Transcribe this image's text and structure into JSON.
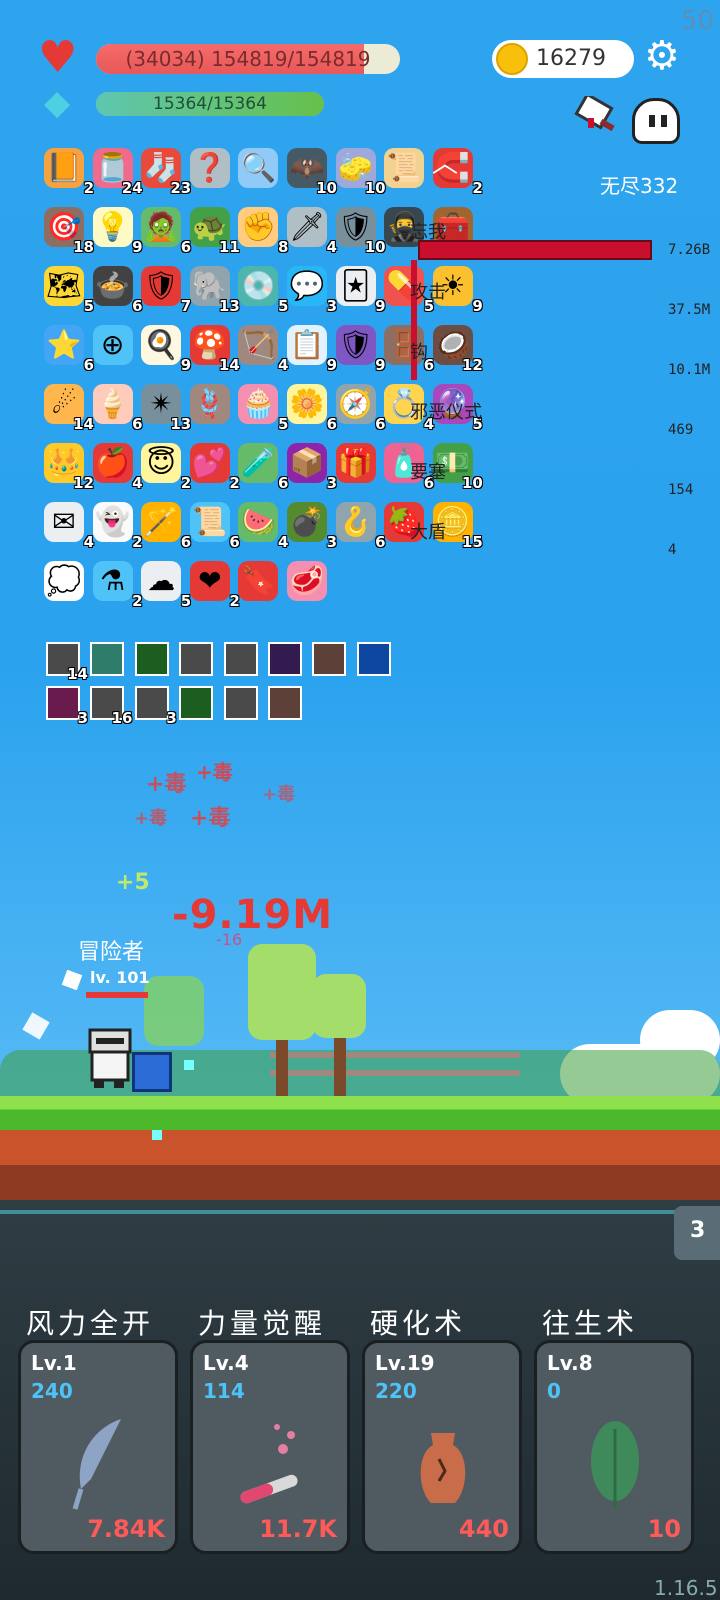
{
  "fps": "50",
  "player": {
    "hp_text": "(34034) 154819/154819",
    "hp_fraction": 0.88,
    "mp_text": "15364/15364",
    "mp_fraction": 1.0,
    "name": "冒险者",
    "level": "lv. 101"
  },
  "coins": "16279",
  "stage": "无尽332",
  "items": [
    {
      "icon": "book-icon",
      "glyph": "📙",
      "count": "2",
      "bg": "#f4a340"
    },
    {
      "icon": "jam-jar-icon",
      "glyph": "🫙",
      "count": "24",
      "bg": "#ef6a8c"
    },
    {
      "icon": "sock-icon",
      "glyph": "🧦",
      "count": "23",
      "bg": "#e84a3c"
    },
    {
      "icon": "hook-icon",
      "glyph": "❓",
      "count": "",
      "bg": "#b0bec5"
    },
    {
      "icon": "magnifier-icon",
      "glyph": "🔍",
      "count": "",
      "bg": "#90caf9"
    },
    {
      "icon": "bat-icon",
      "glyph": "🦇",
      "count": "10",
      "bg": "#455a64"
    },
    {
      "icon": "eraser-icon",
      "glyph": "🧽",
      "count": "10",
      "bg": "#9fa8da"
    },
    {
      "icon": "scroll-icon",
      "glyph": "📜",
      "count": "",
      "bg": "#f2d290"
    },
    {
      "icon": "magnet-icon",
      "glyph": "🧲",
      "count": "2",
      "bg": "#e53935"
    },
    {
      "icon": "target-disk-icon",
      "glyph": "🎯",
      "count": "18",
      "bg": "#8d6e63"
    },
    {
      "icon": "lightbulb-icon",
      "glyph": "💡",
      "count": "9",
      "bg": "#fff9c4"
    },
    {
      "icon": "zombie-icon",
      "glyph": "🧟",
      "count": "6",
      "bg": "#66bb6a"
    },
    {
      "icon": "turtle-shell-icon",
      "glyph": "🐢",
      "count": "11",
      "bg": "#43a047"
    },
    {
      "icon": "fist-icon",
      "glyph": "✊",
      "count": "8",
      "bg": "#ffcc80"
    },
    {
      "icon": "sword-icon",
      "glyph": "🗡",
      "count": "4",
      "bg": "#b0bec5"
    },
    {
      "icon": "shield-icon",
      "glyph": "🛡",
      "count": "10",
      "bg": "#78909c"
    },
    {
      "icon": "hood-icon",
      "glyph": "🥷",
      "count": "",
      "bg": "#37474f"
    },
    {
      "icon": "treasure-chest-icon",
      "glyph": "🧰",
      "count": "",
      "bg": "#a1662f"
    },
    {
      "icon": "map-icon",
      "glyph": "🗺",
      "count": "5",
      "bg": "#fdd835"
    },
    {
      "icon": "cauldron-icon",
      "glyph": "🍲",
      "count": "6",
      "bg": "#424242"
    },
    {
      "icon": "red-shield-icon",
      "glyph": "🛡",
      "count": "7",
      "bg": "#e53935"
    },
    {
      "icon": "elephant-icon",
      "glyph": "🐘",
      "count": "13",
      "bg": "#90a4ae"
    },
    {
      "icon": "disc-icon",
      "glyph": "💿",
      "count": "5",
      "bg": "#4db6ac"
    },
    {
      "icon": "chat-bubble-icon",
      "glyph": "💬",
      "count": "3",
      "bg": "#29b6f6"
    },
    {
      "icon": "playing-card-icon",
      "glyph": "🃏",
      "count": "9",
      "bg": "#eceff1"
    },
    {
      "icon": "pill-icon",
      "glyph": "💊",
      "count": "5",
      "bg": "#ef5350"
    },
    {
      "icon": "sun-icon",
      "glyph": "☀",
      "count": "9",
      "bg": "#fbc02d"
    },
    {
      "icon": "star-ticket-icon",
      "glyph": "⭐",
      "count": "6",
      "bg": "#42a5f5"
    },
    {
      "icon": "crosshair-icon",
      "glyph": "⊕",
      "count": "",
      "bg": "#4fc3f7"
    },
    {
      "icon": "fried-egg-icon",
      "glyph": "🍳",
      "count": "9",
      "bg": "#fff8e1"
    },
    {
      "icon": "mushroom-icon",
      "glyph": "🍄",
      "count": "14",
      "bg": "#e53935"
    },
    {
      "icon": "bow-icon",
      "glyph": "🏹",
      "count": "4",
      "bg": "#a1887f"
    },
    {
      "icon": "clipboard-icon",
      "glyph": "📋",
      "count": "9",
      "bg": "#e3f2fd"
    },
    {
      "icon": "purple-shield-icon",
      "glyph": "🛡",
      "count": "9",
      "bg": "#7e57c2"
    },
    {
      "icon": "door-icon",
      "glyph": "🚪",
      "count": "6",
      "bg": "#8d6e63"
    },
    {
      "icon": "coconut-icon",
      "glyph": "🥥",
      "count": "12",
      "bg": "#6d4c41"
    },
    {
      "icon": "meteor-icon",
      "glyph": "☄",
      "count": "14",
      "bg": "#ffb74d"
    },
    {
      "icon": "ice-cream-icon",
      "glyph": "🍦",
      "count": "6",
      "bg": "#ffccbc"
    },
    {
      "icon": "mace-icon",
      "glyph": "✴",
      "count": "13",
      "bg": "#78909c"
    },
    {
      "icon": "noose-icon",
      "glyph": "🪢",
      "count": "",
      "bg": "#a1887f"
    },
    {
      "icon": "cake-icon",
      "glyph": "🧁",
      "count": "5",
      "bg": "#f48fb1"
    },
    {
      "icon": "flower-icon",
      "glyph": "🌼",
      "count": "6",
      "bg": "#fff59d"
    },
    {
      "icon": "compass-icon",
      "glyph": "🧭",
      "count": "6",
      "bg": "#90a4ae"
    },
    {
      "icon": "ring-icon",
      "glyph": "💍",
      "count": "4",
      "bg": "#ffd54f"
    },
    {
      "icon": "crystal-ball-icon",
      "glyph": "🔮",
      "count": "5",
      "bg": "#ab47bc"
    },
    {
      "icon": "crown-icon",
      "glyph": "👑",
      "count": "12",
      "bg": "#ffca28"
    },
    {
      "icon": "apple-icon",
      "glyph": "🍎",
      "count": "4",
      "bg": "#e53935"
    },
    {
      "icon": "halo-wings-icon",
      "glyph": "😇",
      "count": "2",
      "bg": "#fff59d"
    },
    {
      "icon": "hearts-icon",
      "glyph": "💕",
      "count": "2",
      "bg": "#e53935"
    },
    {
      "icon": "potion-figure-icon",
      "glyph": "🧪",
      "count": "6",
      "bg": "#66bb6a"
    },
    {
      "icon": "purple-box-icon",
      "glyph": "📦",
      "count": "3",
      "bg": "#8e24aa"
    },
    {
      "icon": "gift-icon",
      "glyph": "🎁",
      "count": "",
      "bg": "#e53935"
    },
    {
      "icon": "bottle-icon",
      "glyph": "🧴",
      "count": "6",
      "bg": "#f06292"
    },
    {
      "icon": "money-heart-icon",
      "glyph": "💵",
      "count": "10",
      "bg": "#43a047"
    },
    {
      "icon": "envelope-icon",
      "glyph": "✉",
      "count": "4",
      "bg": "#eceff1"
    },
    {
      "icon": "ghost-icon",
      "glyph": "👻",
      "count": "2",
      "bg": "#fafafa"
    },
    {
      "icon": "magic-wand-icon",
      "glyph": "🪄",
      "count": "6",
      "bg": "#ffb300"
    },
    {
      "icon": "blue-scroll-icon",
      "glyph": "📜",
      "count": "6",
      "bg": "#4fc3f7"
    },
    {
      "icon": "watermelon-icon",
      "glyph": "🍉",
      "count": "4",
      "bg": "#66bb6a"
    },
    {
      "icon": "grenade-icon",
      "glyph": "💣",
      "count": "3",
      "bg": "#558b2f"
    },
    {
      "icon": "grapple-hook-icon",
      "glyph": "🪝",
      "count": "6",
      "bg": "#90a4ae"
    },
    {
      "icon": "strawberry-icon",
      "glyph": "🍓",
      "count": "",
      "bg": "#e53935"
    },
    {
      "icon": "coin-stack-icon",
      "glyph": "🪙",
      "count": "15",
      "bg": "#ffb300"
    },
    {
      "icon": "speech-bubble-icon",
      "glyph": "💭",
      "count": "",
      "bg": "#ffffff"
    },
    {
      "icon": "bubble-potion-icon",
      "glyph": "⚗",
      "count": "2",
      "bg": "#4fc3f7"
    },
    {
      "icon": "cloud-icon",
      "glyph": "☁",
      "count": "5",
      "bg": "#eceff1"
    },
    {
      "icon": "heart-icon",
      "glyph": "❤",
      "count": "2",
      "bg": "#e53935"
    },
    {
      "icon": "bookmark-icon",
      "glyph": "🔖",
      "count": "",
      "bg": "#e53935"
    },
    {
      "icon": "meat-icon",
      "glyph": "🥩",
      "count": "",
      "bg": "#f48fb1"
    }
  ],
  "skill_icons": [
    {
      "icon": "slash-skill-icon",
      "count": "14",
      "bg": "#4a4a4a"
    },
    {
      "icon": "light-skill-icon",
      "count": "",
      "bg": "#2e7d6a"
    },
    {
      "icon": "ghost-skill-icon",
      "count": "",
      "bg": "#1b5e20"
    },
    {
      "icon": "slash-skill-icon",
      "count": "",
      "bg": "#4a4a4a"
    },
    {
      "icon": "slash-skill-icon",
      "count": "",
      "bg": "#4a4a4a"
    },
    {
      "icon": "demon-skill-icon",
      "count": "",
      "bg": "#311b4f"
    },
    {
      "icon": "armor-skill-icon",
      "count": "",
      "bg": "#5d4037"
    },
    {
      "icon": "star-skill-icon",
      "count": "",
      "bg": "#0d47a1"
    },
    {
      "icon": "totem-skill-icon",
      "count": "3",
      "bg": "#6a1b4d"
    },
    {
      "icon": "slash-skill-icon",
      "count": "16",
      "bg": "#4a4a4a"
    },
    {
      "icon": "slash-skill-icon",
      "count": "3",
      "bg": "#4a4a4a"
    },
    {
      "icon": "rune-skill-icon",
      "count": "",
      "bg": "#1b5e20"
    },
    {
      "icon": "slash-skill-icon",
      "count": "",
      "bg": "#4a4a4a"
    },
    {
      "icon": "shield-skill-icon",
      "count": "",
      "bg": "#5d4037"
    }
  ],
  "damage_stats": [
    {
      "label": "忘我",
      "value": "7.26B"
    },
    {
      "label": "攻击",
      "value": "37.5M"
    },
    {
      "label": "钩",
      "value": "10.1M"
    },
    {
      "label": "邪恶仪式",
      "value": "469"
    },
    {
      "label": "要塞",
      "value": "154"
    },
    {
      "label": "大盾",
      "value": "4"
    }
  ],
  "combat": {
    "big_damage": "-9.19M",
    "heal": "+5",
    "small_damage": "-16",
    "poison_text": "+毒"
  },
  "side_tab": "3",
  "skills": [
    {
      "name": "风力全开",
      "level": "Lv.1",
      "value": "240",
      "cost": "7.84K",
      "icon": "feather-icon"
    },
    {
      "name": "力量觉醒",
      "level": "Lv.4",
      "value": "114",
      "cost": "11.7K",
      "icon": "potion-tube-icon"
    },
    {
      "name": "硬化术",
      "level": "Lv.19",
      "value": "220",
      "cost": "440",
      "icon": "vase-icon"
    },
    {
      "name": "往生术",
      "level": "Lv.8",
      "value": "0",
      "cost": "10",
      "icon": "leaf-icon"
    }
  ],
  "version": "1.16.5",
  "colors": {
    "sky": "#2aa2ee",
    "hp": "#e85858",
    "damage": "#e53935",
    "gold": "#f9c00b"
  }
}
